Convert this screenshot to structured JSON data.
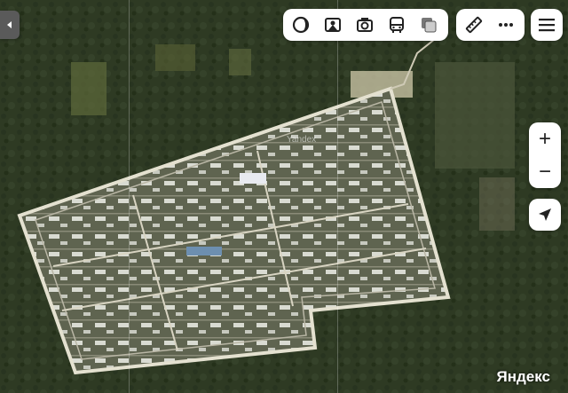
{
  "map": {
    "type": "satellite",
    "watermark": "Yandex",
    "logo": "Яндекс"
  },
  "toolbar": {
    "layers": [
      {
        "icon": "layers-circle-icon"
      },
      {
        "icon": "panorama-icon"
      },
      {
        "icon": "photo-camera-icon"
      },
      {
        "icon": "bus-icon"
      },
      {
        "icon": "map-layers-square-icon"
      }
    ],
    "tools": [
      {
        "icon": "ruler-icon"
      },
      {
        "icon": "more-dots-icon"
      }
    ]
  },
  "controls": {
    "zoom_in": "+",
    "zoom_out": "−"
  },
  "colors": {
    "forest": "#2f3a24",
    "compound": "#6f705f",
    "road": "#d8d4c2",
    "accent": "#2a2a2a"
  }
}
